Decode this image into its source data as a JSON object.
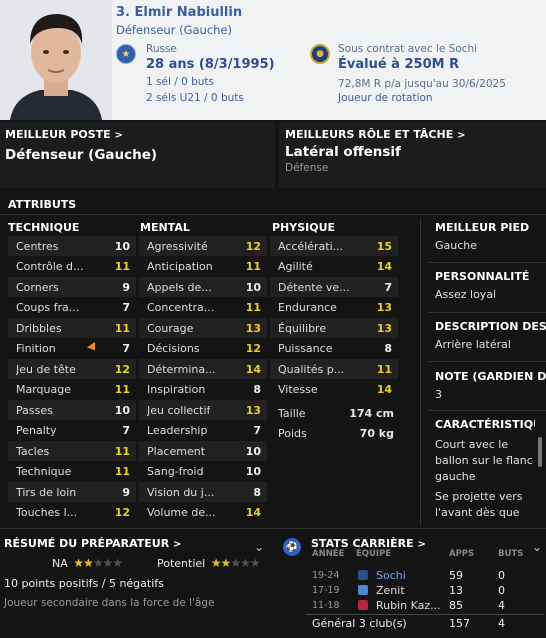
{
  "header": {
    "name": "3. Elmir Nabiullin",
    "position": "Défenseur (Gauche)",
    "nationality": "Russe",
    "age": "28 ans (8/3/1995)",
    "caps": "1 sél / 0 buts",
    "u21_caps": "2 séls U21 / 0 buts",
    "contract": "Sous contrat avec le Sochi",
    "value": "Évalué à 250M R",
    "wage": "72,8M R p/a jusqu'au 30/6/2025",
    "role_status": "Joueur de rotation"
  },
  "best_position": {
    "title": "MEILLEUR POSTE",
    "value": "Défenseur (Gauche)"
  },
  "best_role": {
    "title": "MEILLEURS RÔLE ET TÂCHE",
    "value": "Latéral offensif",
    "duty": "Défense"
  },
  "attributes": {
    "title": "ATTRIBUTS",
    "technical": {
      "title": "TECHNIQUE",
      "items": [
        {
          "label": "Centres",
          "value": "10",
          "hl": false
        },
        {
          "label": "Contrôle d...",
          "value": "11",
          "hl": true
        },
        {
          "label": "Corners",
          "value": "9",
          "hl": false
        },
        {
          "label": "Coups fra...",
          "value": "7",
          "hl": false
        },
        {
          "label": "Dribbles",
          "value": "11",
          "hl": true
        },
        {
          "label": "Finition",
          "value": "7",
          "hl": false
        },
        {
          "label": "Jeu de tête",
          "value": "12",
          "hl": true
        },
        {
          "label": "Marquage",
          "value": "11",
          "hl": true
        },
        {
          "label": "Passes",
          "value": "10",
          "hl": false
        },
        {
          "label": "Penalty",
          "value": "7",
          "hl": false
        },
        {
          "label": "Tacles",
          "value": "11",
          "hl": true
        },
        {
          "label": "Technique",
          "value": "11",
          "hl": true
        },
        {
          "label": "Tirs de loin",
          "value": "9",
          "hl": false
        },
        {
          "label": "Touches l...",
          "value": "12",
          "hl": true
        }
      ]
    },
    "mental": {
      "title": "MENTAL",
      "items": [
        {
          "label": "Agressivité",
          "value": "12",
          "hl": true
        },
        {
          "label": "Anticipation",
          "value": "11",
          "hl": true
        },
        {
          "label": "Appels de...",
          "value": "10",
          "hl": false
        },
        {
          "label": "Concentra...",
          "value": "11",
          "hl": true
        },
        {
          "label": "Courage",
          "value": "13",
          "hl": true
        },
        {
          "label": "Décisions",
          "value": "12",
          "hl": true
        },
        {
          "label": "Détermina...",
          "value": "14",
          "hl": true
        },
        {
          "label": "Inspiration",
          "value": "8",
          "hl": false
        },
        {
          "label": "Jeu collectif",
          "value": "13",
          "hl": true
        },
        {
          "label": "Leadership",
          "value": "7",
          "hl": false
        },
        {
          "label": "Placement",
          "value": "10",
          "hl": false
        },
        {
          "label": "Sang-froid",
          "value": "10",
          "hl": false
        },
        {
          "label": "Vision du j...",
          "value": "8",
          "hl": false
        },
        {
          "label": "Volume de...",
          "value": "14",
          "hl": true
        }
      ]
    },
    "physical": {
      "title": "PHYSIQUE",
      "items": [
        {
          "label": "Accélérati...",
          "value": "15",
          "hl": true
        },
        {
          "label": "Agilité",
          "value": "14",
          "hl": true
        },
        {
          "label": "Détente ve...",
          "value": "7",
          "hl": false
        },
        {
          "label": "Endurance",
          "value": "13",
          "hl": true
        },
        {
          "label": "Équilibre",
          "value": "13",
          "hl": true
        },
        {
          "label": "Puissance",
          "value": "8",
          "hl": false
        },
        {
          "label": "Qualités p...",
          "value": "11",
          "hl": true
        },
        {
          "label": "Vitesse",
          "value": "14",
          "hl": true
        }
      ]
    },
    "height": {
      "label": "Taille",
      "value": "174 cm"
    },
    "weight": {
      "label": "Poids",
      "value": "70 kg"
    }
  },
  "sidebar": {
    "foot": {
      "title": "MEILLEUR PIED",
      "value": "Gauche"
    },
    "personality": {
      "title": "PERSONNALITÉ",
      "value": "Assez loyal"
    },
    "description": {
      "title": "DESCRIPTION DES...",
      "value": "Arrière latéral"
    },
    "gk_rating": {
      "title": "NOTE (GARDIEN D...",
      "value": "3"
    },
    "traits": {
      "title": "CARACTÉRISTIQU...",
      "items": [
        "Court avec le ballon sur le flanc gauche",
        "Se projette vers l'avant dès que"
      ]
    }
  },
  "coach_report": {
    "title": "RÉSUMÉ DU PRÉPARATEUR",
    "current_label": "NA",
    "current_stars": 2.5,
    "potential_label": "Potentiel",
    "potential_stars": 2.5,
    "summary": "10 points positifs / 5 négatifs",
    "note": "Joueur secondaire dans la force de l'âge"
  },
  "career": {
    "title": "STATS CARRIÈRE",
    "headers": {
      "year": "ANNÉE",
      "team": "ÉQUIPE",
      "apps": "APPS",
      "goals": "BUTS"
    },
    "rows": [
      {
        "year": "19-24",
        "team": "Sochi",
        "apps": "59",
        "goals": "0",
        "color": "#6aa6ff"
      },
      {
        "year": "17-19",
        "team": "Zenit",
        "apps": "13",
        "goals": "0",
        "color": "#dcdcdc"
      },
      {
        "year": "11-18",
        "team": "Rubin Kaz...",
        "apps": "85",
        "goals": "4",
        "color": "#dcdcdc"
      }
    ],
    "total": {
      "label": "Général 3 club(s)",
      "apps": "157",
      "goals": "4"
    }
  }
}
